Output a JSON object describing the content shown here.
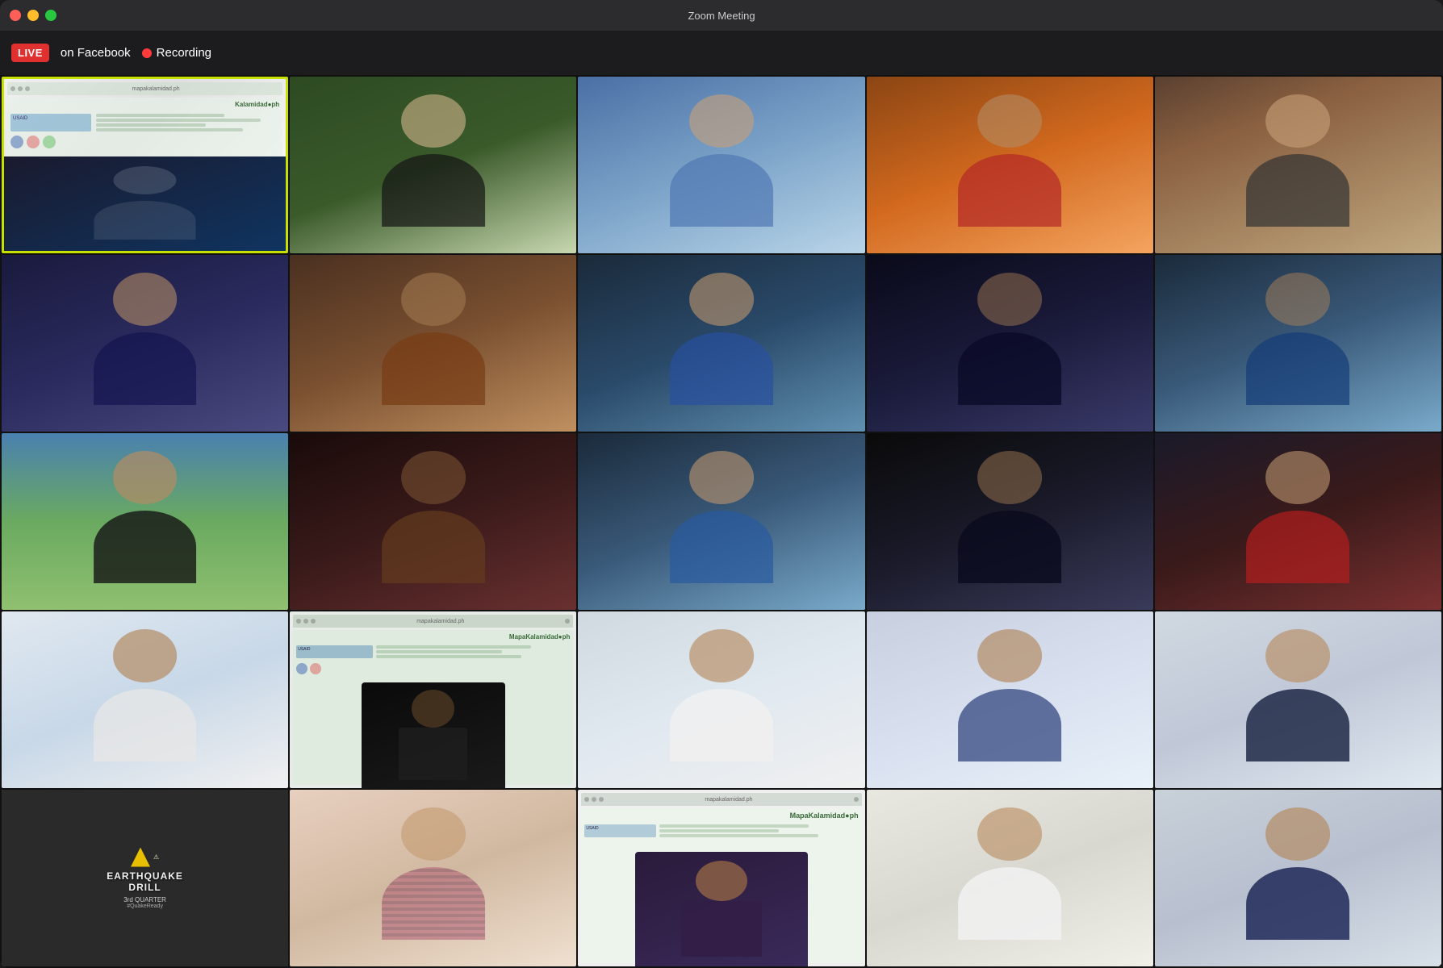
{
  "window": {
    "title": "Zoom Meeting"
  },
  "toolbar": {
    "live_badge": "LIVE",
    "on_facebook": "on Facebook",
    "recording_label": "Recording"
  },
  "grid": {
    "cells": [
      {
        "id": 1,
        "type": "screen_share",
        "label": "mapakalamidad.ph",
        "active_speaker": true
      },
      {
        "id": 2,
        "type": "person",
        "label": "",
        "style": "person-2"
      },
      {
        "id": 3,
        "type": "person",
        "label": "",
        "style": "person-3"
      },
      {
        "id": 4,
        "type": "person",
        "label": "",
        "style": "person-4"
      },
      {
        "id": 5,
        "type": "person",
        "label": "",
        "style": "person-5"
      },
      {
        "id": 6,
        "type": "person",
        "label": "",
        "style": "person-6"
      },
      {
        "id": 7,
        "type": "person",
        "label": "",
        "style": "person-7"
      },
      {
        "id": 8,
        "type": "person",
        "label": "",
        "style": "person-8"
      },
      {
        "id": 9,
        "type": "person",
        "label": "",
        "style": "person-9"
      },
      {
        "id": 10,
        "type": "person",
        "label": "",
        "style": "person-10"
      },
      {
        "id": 11,
        "type": "person",
        "label": "",
        "style": "person-11"
      },
      {
        "id": 12,
        "type": "person",
        "label": "",
        "style": "person-12"
      },
      {
        "id": 13,
        "type": "person",
        "label": "",
        "style": "person-13"
      },
      {
        "id": 14,
        "type": "person",
        "label": "",
        "style": "person-14"
      },
      {
        "id": 15,
        "type": "person",
        "label": "",
        "style": "person-15"
      },
      {
        "id": 16,
        "type": "person",
        "label": "",
        "style": "person-16"
      },
      {
        "id": 17,
        "type": "screen_share_2",
        "label": "mapakalamidad.ph",
        "active_speaker": false
      },
      {
        "id": 18,
        "type": "person",
        "label": "",
        "style": "person-18"
      },
      {
        "id": 19,
        "type": "person",
        "label": "",
        "style": "person-19"
      },
      {
        "id": 20,
        "type": "person",
        "label": "",
        "style": "person-20"
      },
      {
        "id": 21,
        "type": "earthquake",
        "label": "",
        "style": "earthquake-bg"
      },
      {
        "id": 22,
        "type": "person",
        "label": "",
        "style": "person-22"
      },
      {
        "id": 23,
        "type": "screen_share_3",
        "label": "mapakalamidad.ph",
        "active_speaker": false
      },
      {
        "id": 24,
        "type": "person",
        "label": "",
        "style": "person-24"
      },
      {
        "id": 25,
        "type": "person",
        "label": "",
        "style": "person-25"
      }
    ]
  }
}
